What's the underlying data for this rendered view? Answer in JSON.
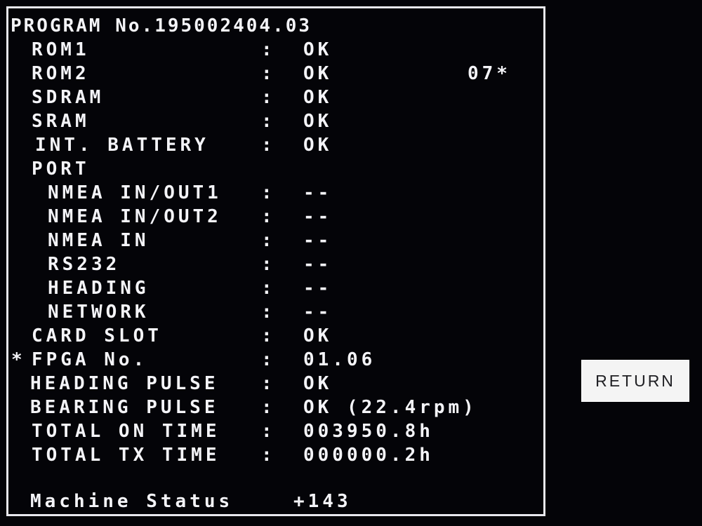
{
  "program": {
    "label": "PROGRAM No.",
    "number": "195002404.03"
  },
  "rows": [
    {
      "name": "ROM1",
      "sep": ":",
      "value": "OK"
    },
    {
      "name": "ROM2",
      "sep": ":",
      "value": "OK",
      "extra": "07*"
    },
    {
      "name": "SDRAM",
      "sep": ":",
      "value": "OK"
    },
    {
      "name": "SRAM",
      "sep": ":",
      "value": "OK"
    },
    {
      "name": "INT. BATTERY",
      "sep": ":",
      "value": "OK"
    },
    {
      "name": "PORT"
    },
    {
      "name": "NMEA IN/OUT1",
      "sep": ":",
      "value": "--"
    },
    {
      "name": "NMEA IN/OUT2",
      "sep": ":",
      "value": "--"
    },
    {
      "name": "NMEA IN",
      "sep": ":",
      "value": "--"
    },
    {
      "name": "RS232",
      "sep": ":",
      "value": "--"
    },
    {
      "name": "HEADING",
      "sep": ":",
      "value": "--"
    },
    {
      "name": "NETWORK",
      "sep": ":",
      "value": "--"
    },
    {
      "name": "CARD SLOT",
      "sep": ":",
      "value": "OK"
    },
    {
      "marker": "*",
      "name": "FPGA No.",
      "sep": ":",
      "value": "01.06"
    },
    {
      "name": "HEADING PULSE",
      "sep": ":",
      "value": "OK"
    },
    {
      "name": "BEARING PULSE",
      "sep": ":",
      "value": "OK (22.4rpm)"
    },
    {
      "name": "TOTAL ON TIME",
      "sep": ":",
      "value": "003950.8h"
    },
    {
      "name": "TOTAL TX TIME",
      "sep": ":",
      "value": "000000.2h"
    }
  ],
  "machine_status": {
    "label": "Machine Status",
    "value": "+143"
  },
  "return_button": {
    "label": "RETURN"
  },
  "colors": {
    "background": "#040408",
    "text": "#f4f4f8",
    "frame": "#e8e8ee",
    "button_bg": "#f4f4f4",
    "button_text": "#202024"
  }
}
